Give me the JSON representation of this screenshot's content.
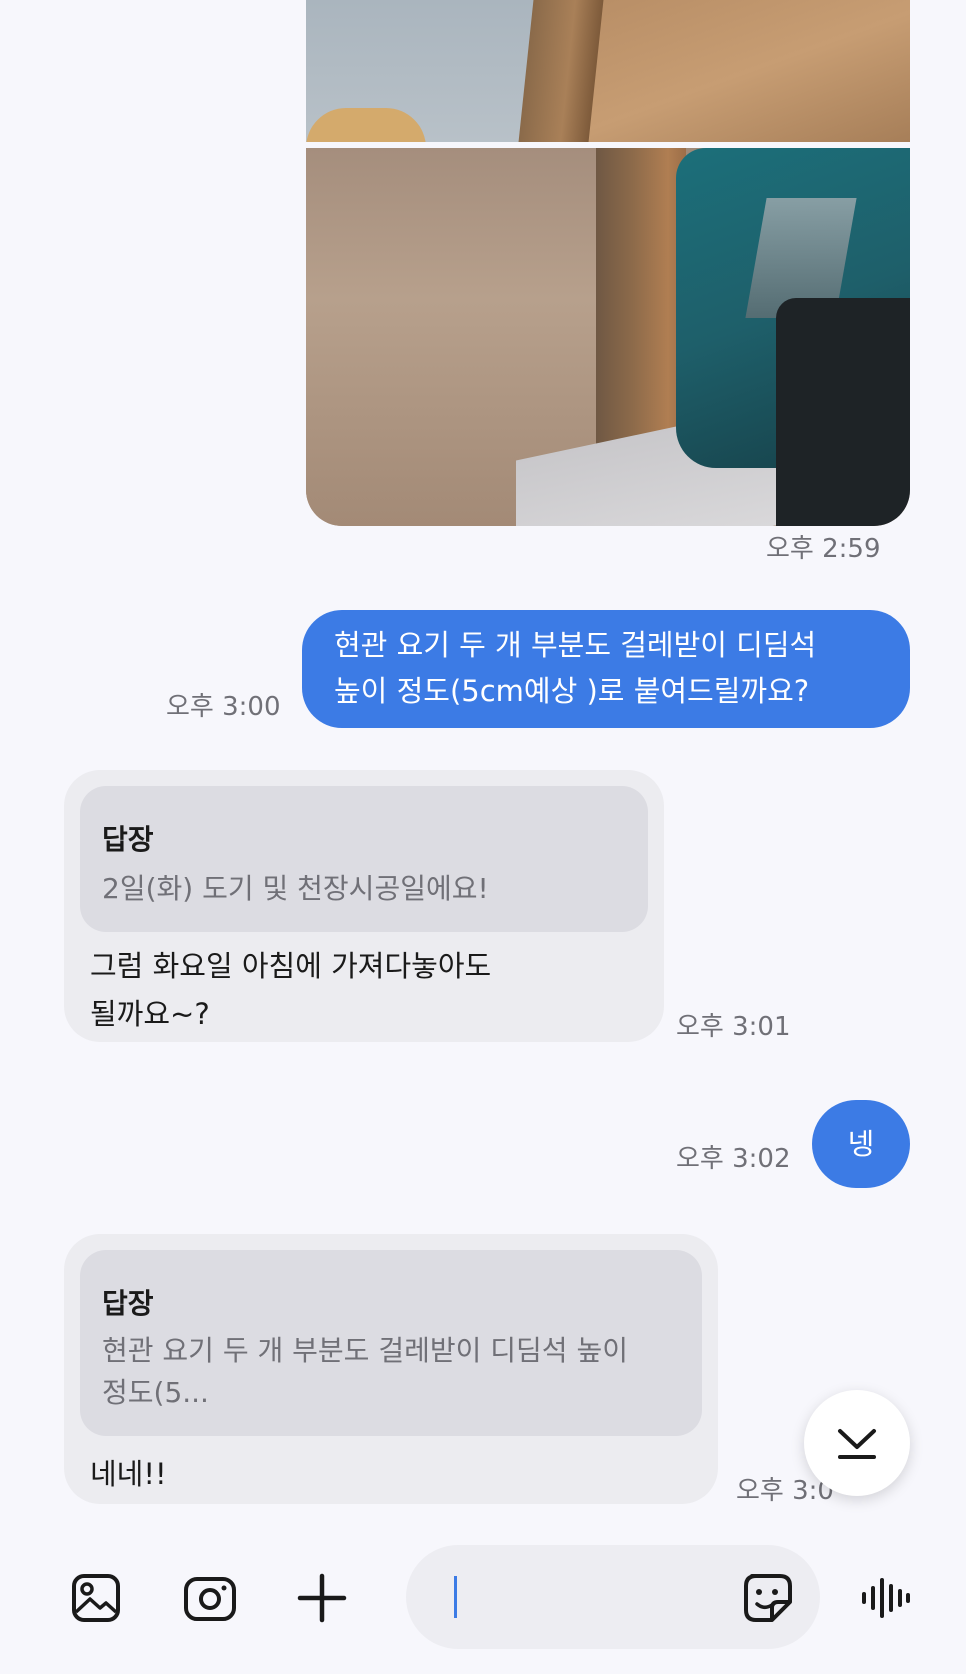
{
  "messages": {
    "photo_time": "오후 2:59",
    "out1": {
      "line1": "현관 요기 두 개 부분도 걸레받이 디딤석",
      "line2": "높이 정도(5cm예상 )로 붙여드릴까요?",
      "time": "오후 3:00"
    },
    "in1": {
      "quote_title": "답장",
      "quote_text": "2일(화) 도기 및 천장시공일에요!",
      "line1": "그럼 화요일 아침에 가져다놓아도",
      "line2": "될까요~?",
      "time": "오후 3:01"
    },
    "out2": {
      "text": "넹",
      "time": "오후 3:02"
    },
    "in2": {
      "quote_title": "답장",
      "quote_line1": "현관 요기 두 개 부분도 걸레받이 디딤석 높이",
      "quote_line2": "정도(5...",
      "text": "네네!!",
      "time": "오후 3:0"
    }
  },
  "icons": {
    "gallery": "gallery-icon",
    "camera": "camera-icon",
    "plus": "plus-icon",
    "sticker": "sticker-icon",
    "voice": "voice-icon",
    "scroll_down": "chevron-down-icon"
  },
  "colors": {
    "outgoing": "#3c7be5",
    "incoming": "#ececf0",
    "quote": "#dcdce2",
    "background": "#f7f7fc"
  }
}
